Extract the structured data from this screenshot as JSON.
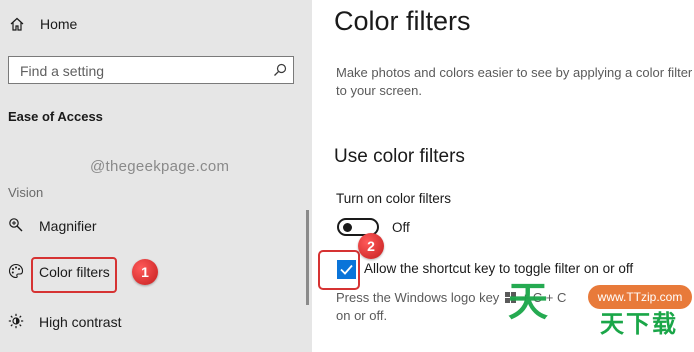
{
  "sidebar": {
    "home_label": "Home",
    "search": {
      "placeholder": "Find a setting"
    },
    "section_title": "Ease of Access",
    "watermark": "@thegeekpage.com",
    "group_label": "Vision",
    "items": [
      {
        "label": "Magnifier",
        "icon": "magnifier-icon"
      },
      {
        "label": "Color filters",
        "icon": "palette-icon"
      },
      {
        "label": "High contrast",
        "icon": "brightness-icon"
      }
    ]
  },
  "callouts": {
    "first": "1",
    "second": "2"
  },
  "main": {
    "title": "Color filters",
    "description": "Make photos and colors easier to see by applying a color filter to your screen.",
    "subheading": "Use color filters",
    "toggle_label": "Turn on color filters",
    "toggle_state": "Off",
    "checkbox_label": "Allow the shortcut key to toggle filter on or off",
    "hint_line1_a": "Press the Windows logo key",
    "hint_line1_b": "+ C",
    "hint_line1_c": "+ C",
    "hint_line2": "on or off.",
    "accent_color": "#0a74d9"
  },
  "watermark_overlay": {
    "badge": "www.TTzip.com",
    "glyph": "天",
    "row": "天下载"
  }
}
